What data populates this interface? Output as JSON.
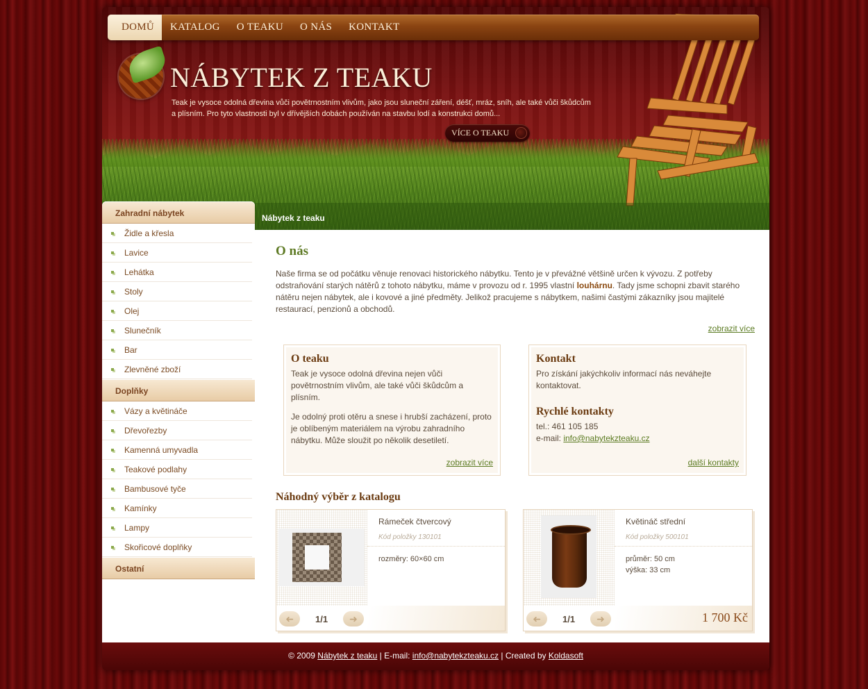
{
  "nav": {
    "items": [
      "DOMŮ",
      "KATALOG",
      "O TEAKU",
      "O NÁS",
      "KONTAKT"
    ]
  },
  "hero": {
    "title": "NÁBYTEK Z TEAKU",
    "intro": "Teak je vysoce odolná dřevina vůči povětrnostním vlivům, jako jsou sluneční záření, déšť, mráz, sníh, ale také vůči škůdcům a plísním. Pro tyto vlastnosti byl v dřívějších dobách používán na stavbu lodí a konstrukci domů...",
    "more_button": "VÍCE O TEAKU"
  },
  "breadcrumb": "Nábytek z teaku",
  "sidebar": {
    "cat1": {
      "title": "Zahradní nábytek",
      "items": [
        "Židle a křesla",
        "Lavice",
        "Lehátka",
        "Stoly",
        "Olej",
        "Slunečník",
        "Bar",
        "Zlevněné zboží"
      ]
    },
    "cat2": {
      "title": "Doplňky",
      "items": [
        "Vázy a květináče",
        "Dřevořezby",
        "Kamenná umyvadla",
        "Teakové podlahy",
        "Bambusové tyče",
        "Kamínky",
        "Lampy",
        "Skořicové doplňky"
      ]
    },
    "cat3": {
      "title": "Ostatní"
    }
  },
  "main": {
    "heading": "O nás",
    "intro_before": "Naše firma se od počátku věnuje renovaci historického nábytku. Tento je v převážné většině určen k vývozu. Z potřeby odstraňování starých nátěrů z tohoto nábytku, máme v provozu od r. 1995 vlastní ",
    "intro_bold": "louhárnu",
    "intro_after": ". Tady jsme schopni zbavit starého nátěru nejen nábytek, ale i kovové a jiné předměty. Jelikož pracujeme s nábytkem, našimi častými zákazníky jsou majitelé restaurací, penzionů a obchodů.",
    "intro_more": "zobrazit více"
  },
  "box_teak": {
    "title": "O teaku",
    "p1": "Teak je vysoce odolná dřevina nejen vůči povětrnostním vlivům, ale také vůči škůdcům a plísním.",
    "p2": "Je odolný proti otěru a snese i hrubší zacházení, proto je oblíbeným materiálem na výrobu zahradního nábytku. Může sloužit po několik desetiletí.",
    "more": "zobrazit více"
  },
  "box_contact": {
    "title": "Kontakt",
    "p1": "Pro získání jakýchkoliv informací nás neváhejte kontaktovat.",
    "quick_title": "Rychlé kontakty",
    "tel": "tel.: 461 105 185",
    "email_label": "e-mail: ",
    "email": "info@nabytekzteaku.cz",
    "more": "další kontakty"
  },
  "random": {
    "heading": "Náhodný výběr z katalogu",
    "products": [
      {
        "name": "Rámeček čtvercový",
        "code": "Kód položky 130101",
        "attr1": "rozměry: 60×60 cm",
        "attr2": "",
        "pager": "1/1",
        "price": ""
      },
      {
        "name": "Květináč střední",
        "code": "Kód položky 500101",
        "attr1": "průměr: 50 cm",
        "attr2": "výška: 33 cm",
        "pager": "1/1",
        "price": "1 700 Kč"
      }
    ]
  },
  "footer": {
    "prefix": "© 2009 ",
    "site_link": "Nábytek z teaku",
    "mid": " | E-mail: ",
    "email": "info@nabytekzteaku.cz",
    "mid2": " | Created by ",
    "author": "Koldasoft"
  },
  "colors": {
    "accent_green": "#5e7a24",
    "brand_brown": "#6a3a10",
    "background_red": "#5c0a0a"
  }
}
